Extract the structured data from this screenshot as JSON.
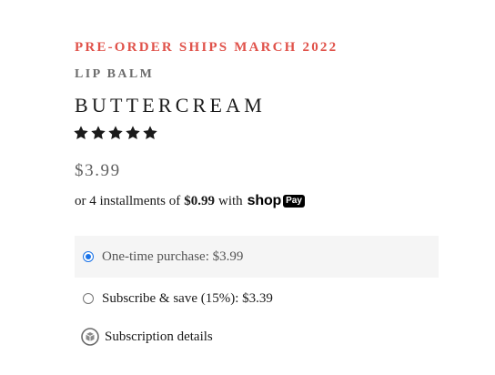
{
  "product": {
    "preorder_note": "PRE-ORDER SHIPS MARCH 2022",
    "category": "LIP BALM",
    "title": "BUTTERCREAM",
    "rating_stars": 5,
    "price": "$3.99"
  },
  "installments": {
    "prefix": "or 4 installments of",
    "amount": "$0.99",
    "with": "with",
    "shop_label": "shop",
    "pay_label": "Pay"
  },
  "purchase_options": [
    {
      "label": "One-time purchase: $3.99",
      "selected": true
    },
    {
      "label": "Subscribe & save (15%): $3.39",
      "selected": false
    }
  ],
  "subscription_details": {
    "label": "Subscription details",
    "icon": "subscription-box-icon"
  },
  "colors": {
    "preorder": "#e0524a",
    "radio_selected": "#1a73e8",
    "selected_bg": "#f5f5f5"
  }
}
